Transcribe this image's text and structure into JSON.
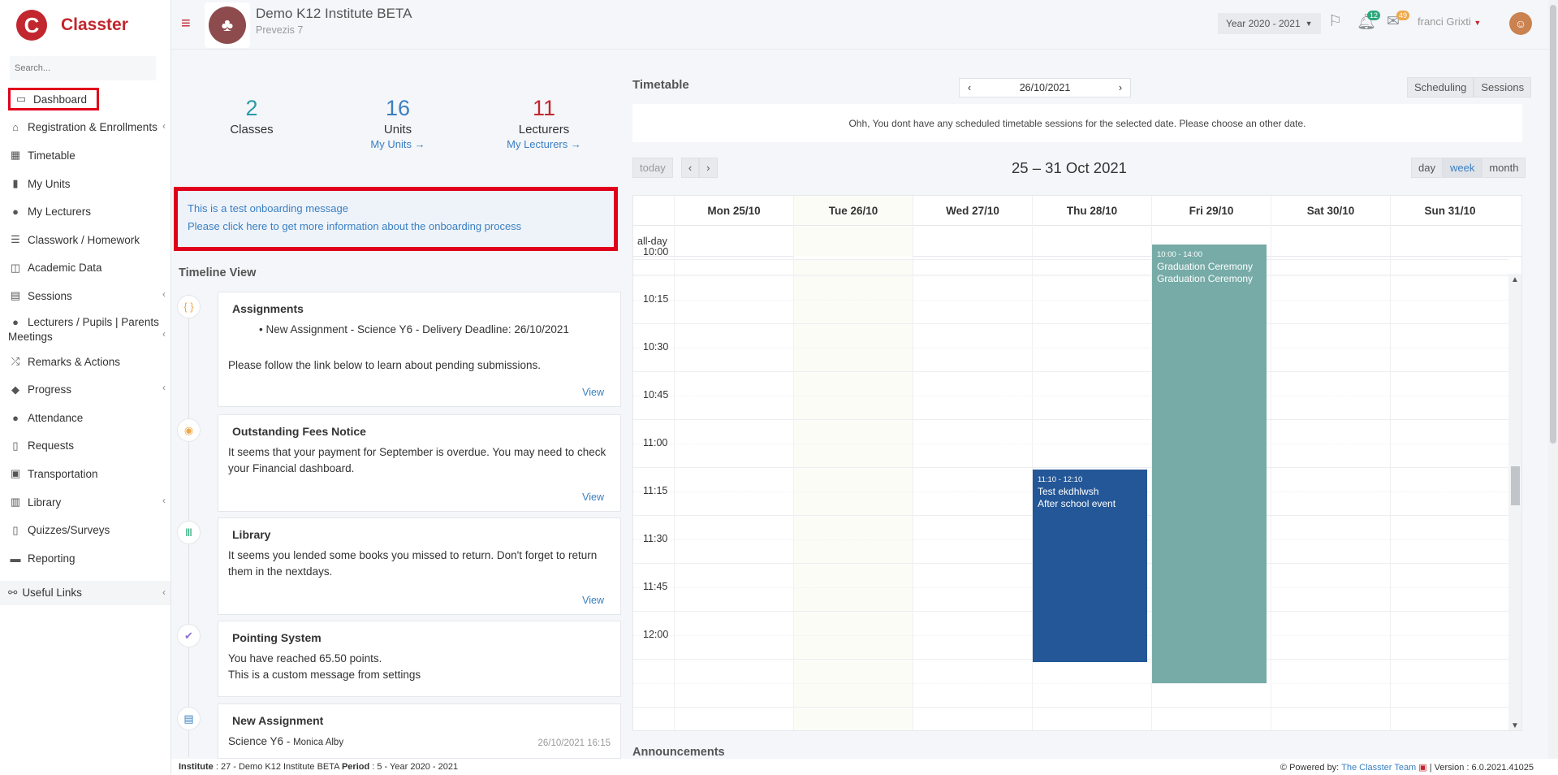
{
  "app": {
    "name": "Classter",
    "logo_letter": "C"
  },
  "sidebar": {
    "search_placeholder": "Search...",
    "items": [
      {
        "label": "Dashboard",
        "icon": "laptop-icon"
      },
      {
        "label": "Registration & Enrollments",
        "icon": "institution-icon"
      },
      {
        "label": "Timetable",
        "icon": "calendar-icon"
      },
      {
        "label": "My Units",
        "icon": "book-icon"
      },
      {
        "label": "My Lecturers",
        "icon": "users-icon"
      },
      {
        "label": "Classwork / Homework",
        "icon": "list-icon"
      },
      {
        "label": "Academic Data",
        "icon": "chart-icon"
      },
      {
        "label": "Sessions",
        "icon": "sessions-icon"
      },
      {
        "label": "Lecturers / Pupils | Parents Meetings",
        "icon": "meeting-icon"
      },
      {
        "label": "Remarks & Actions",
        "icon": "shuffle-icon"
      },
      {
        "label": "Progress",
        "icon": "graduation-cap-icon"
      },
      {
        "label": "Attendance",
        "icon": "user-check-icon"
      },
      {
        "label": "Requests",
        "icon": "document-icon"
      },
      {
        "label": "Transportation",
        "icon": "bus-icon"
      },
      {
        "label": "Library",
        "icon": "library-icon"
      },
      {
        "label": "Quizzes/Surveys",
        "icon": "quiz-icon"
      },
      {
        "label": "Reporting",
        "icon": "print-icon"
      }
    ],
    "useful_links": "Useful Links"
  },
  "header": {
    "institute_name": "Demo K12 Institute BETA",
    "institute_sub": "Prevezis 7",
    "year": "Year 2020 - 2021",
    "notif_count": "12",
    "mail_count": "49",
    "user_name": "franci Grixti"
  },
  "stats": [
    {
      "num": "2",
      "label": "Classes",
      "link": "",
      "color": "#2b9aa8"
    },
    {
      "num": "16",
      "label": "Units",
      "link": "My Units →",
      "color": "#3a7fc1"
    },
    {
      "num": "11",
      "label": "Lecturers",
      "link": "My Lecturers →",
      "color": "#c2262e"
    }
  ],
  "onboarding": {
    "line1": "This is a test onboarding message",
    "line2": "Please click here to get more information about the onboarding process"
  },
  "timeline": {
    "title": "Timeline View",
    "cards": [
      {
        "title": "Assignments",
        "bullet": "New Assignment - Science Y6 - Delivery Deadline: 26/10/2021",
        "text": "Please follow the link below to learn about pending submissions.",
        "view": "View"
      },
      {
        "title": "Outstanding Fees Notice",
        "text": "It seems that your payment for September is overdue. You may need to check your Financial dashboard.",
        "view": "View"
      },
      {
        "title": "Library",
        "text": "It seems you lended some books you missed to return. Don't forget to return them in the nextdays.",
        "view": "View"
      },
      {
        "title": "Pointing System",
        "text": "You have reached 65.50 points.",
        "text2": "This is a custom message from settings"
      },
      {
        "title": "New Assignment",
        "text": "Science Y6",
        "author": "Monica Alby",
        "date": "26/10/2021 16:15"
      }
    ]
  },
  "timetable": {
    "title": "Timetable",
    "date": "26/10/2021",
    "scheduling": "Scheduling",
    "sessions": "Sessions",
    "notice": "Ohh, You dont have any scheduled timetable sessions for the selected date. Please choose an other date.",
    "today": "today",
    "range": "25 – 31 Oct 2021",
    "views": [
      "day",
      "week",
      "month"
    ],
    "days": [
      "Mon 25/10",
      "Tue 26/10",
      "Wed 27/10",
      "Thu 28/10",
      "Fri 29/10",
      "Sat 30/10",
      "Sun 31/10"
    ],
    "allday": "all-day",
    "times": [
      "10:00",
      "10:15",
      "10:30",
      "10:45",
      "11:00",
      "11:15",
      "11:30",
      "11:45",
      "12:00"
    ],
    "events": [
      {
        "time": "10:00 - 14:00",
        "title": "Graduation Ceremony",
        "subtitle": "Graduation Ceremony",
        "color": "#76aba7"
      },
      {
        "time": "11:10 - 12:10",
        "title": "Test ekdhlwsh",
        "subtitle": "After school event",
        "color": "#245797"
      }
    ],
    "announcements": "Announcements"
  },
  "footer": {
    "institute_label": "Institute",
    "institute_value": ": 27 - Demo K12 Institute BETA",
    "period_label": "Period",
    "period_value": ": 5 - Year 2020 - 2021",
    "powered_label": "Powered by:",
    "powered_team": "The Classter Team",
    "version": "| Version : 6.0.2021.41025"
  }
}
